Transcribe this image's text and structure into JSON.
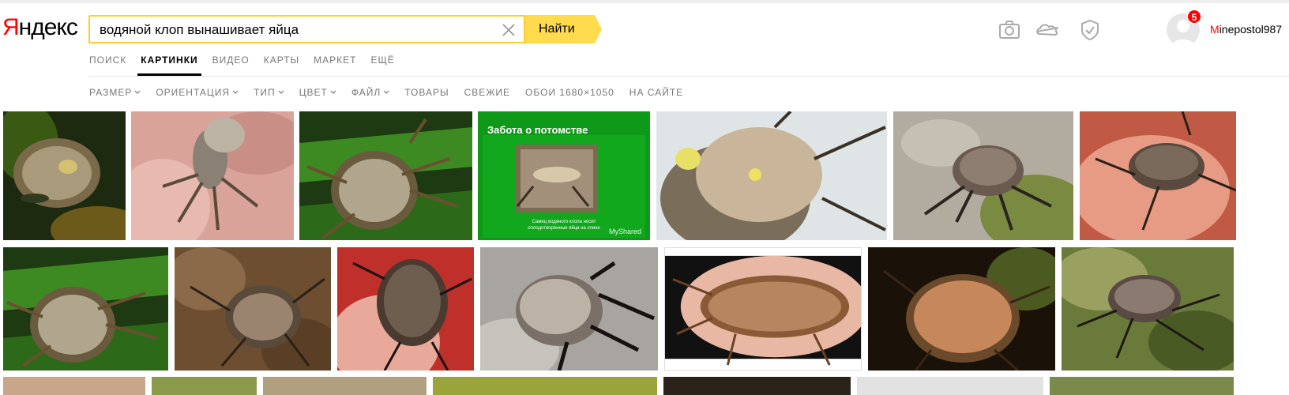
{
  "logo": {
    "first_letter": "Я",
    "rest": "ндекс"
  },
  "search": {
    "value": "водяной клоп вынашивает яйца",
    "button_label": "Найти"
  },
  "services": [
    {
      "label": "ПОИСК",
      "active": false
    },
    {
      "label": "КАРТИНКИ",
      "active": true
    },
    {
      "label": "ВИДЕО",
      "active": false
    },
    {
      "label": "КАРТЫ",
      "active": false
    },
    {
      "label": "МАРКЕТ",
      "active": false
    },
    {
      "label": "ЕЩЁ",
      "active": false
    }
  ],
  "filters": [
    {
      "label": "РАЗМЕР",
      "dropdown": true
    },
    {
      "label": "ОРИЕНТАЦИЯ",
      "dropdown": true
    },
    {
      "label": "ТИП",
      "dropdown": true
    },
    {
      "label": "ЦВЕТ",
      "dropdown": true
    },
    {
      "label": "ФАЙЛ",
      "dropdown": true
    },
    {
      "label": "ТОВАРЫ",
      "dropdown": false
    },
    {
      "label": "СВЕЖИЕ",
      "dropdown": false
    },
    {
      "label": "ОБОИ 1680×1050",
      "dropdown": false
    },
    {
      "label": "НА САЙТЕ",
      "dropdown": false
    }
  ],
  "header_icons": [
    "camera-icon",
    "cloud-icon",
    "shield-check-icon"
  ],
  "user": {
    "badge_count": "5",
    "name_first": "M",
    "name_rest": "inepostol987"
  },
  "results": {
    "featured_slide": {
      "title": "Забота о потомстве",
      "caption_line1": "Самец водяного клопа носит",
      "caption_line2": "оплодотворенные яйца на спине",
      "brand": "MyShared"
    }
  },
  "colors": {
    "accent": "#ffdb4d",
    "search_border": "#fc3",
    "logo_red": "#ff0000",
    "badge_red": "#ff0000"
  }
}
